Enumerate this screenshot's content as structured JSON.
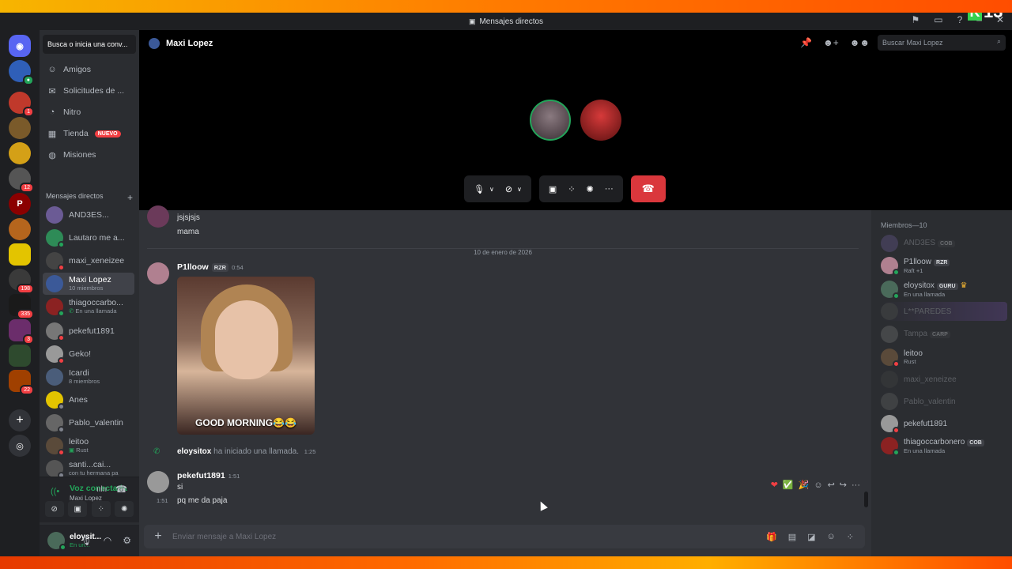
{
  "window": {
    "title": "Mensajes directos",
    "badge_letter": "K",
    "badge_number": "13"
  },
  "sidebar": {
    "search_label": "Busca o inicia una conv...",
    "nav": [
      {
        "label": "Amigos",
        "icon": "friends-icon"
      },
      {
        "label": "Solicitudes de ...",
        "icon": "mail-icon"
      },
      {
        "label": "Nitro",
        "icon": "nitro-icon"
      },
      {
        "label": "Tienda",
        "icon": "shop-icon",
        "badge": "NUEVO"
      },
      {
        "label": "Misiones",
        "icon": "quests-icon"
      }
    ],
    "dm_header": "Mensajes directos",
    "dms": [
      {
        "name": "AND3ES...",
        "sub": ""
      },
      {
        "name": "Lautaro me a...",
        "sub": ""
      },
      {
        "name": "maxi_xeneizee",
        "sub": ""
      },
      {
        "name": "Maxi Lopez",
        "sub": "10 miembros"
      },
      {
        "name": "thiagoccarbo...",
        "sub": "En una llamada"
      },
      {
        "name": "pekefut1891",
        "sub": ""
      },
      {
        "name": "Geko!",
        "sub": ""
      },
      {
        "name": "Icardi",
        "sub": "8 miembros"
      },
      {
        "name": "Anes",
        "sub": ""
      },
      {
        "name": "Pablo_valentin",
        "sub": ""
      },
      {
        "name": "leitoo",
        "sub": "Rust"
      },
      {
        "name": "santi...cai...",
        "sub": "con tu hermana pa"
      }
    ],
    "guild_badges": [
      "1",
      "12",
      "198",
      "335",
      "3",
      "22"
    ],
    "voice": {
      "status": "Voz conectada",
      "channel": "Maxi Lopez"
    },
    "user": {
      "name": "eloysit...",
      "sub": "En un..."
    }
  },
  "call": {
    "title": "Maxi Lopez",
    "search_placeholder": "Buscar Maxi Lopez"
  },
  "chat": {
    "prev_lines": [
      "jsjsjsjs",
      "mama"
    ],
    "date_divider": "10 de enero de 2026",
    "messages": [
      {
        "author": "P1lloow",
        "tag": "RZR",
        "time": "0:54",
        "gif_caption": "GOOD MORNING😂😂"
      },
      {
        "author": "eloysitox",
        "system": "ha iniciado una llamada.",
        "time": "1:25"
      },
      {
        "author": "pekefut1891",
        "time": "1:51",
        "lines": [
          "si",
          "pq me da paja"
        ],
        "line_time": "1:51"
      }
    ],
    "composer_placeholder": "Enviar mensaje a Maxi Lopez"
  },
  "members": {
    "header": "Miembros—10",
    "list": [
      {
        "name": "AND3ES",
        "badge": "COB",
        "sub": "",
        "dim": true
      },
      {
        "name": "P1lloow",
        "badge": "RZR",
        "sub": "Raft +1",
        "dim": false
      },
      {
        "name": "eloysitox",
        "badge": "GURU",
        "sub": "En una llamada",
        "dim": false
      },
      {
        "name": "L**PAREDES",
        "badge": "",
        "sub": "",
        "dim": true
      },
      {
        "name": "Tampa",
        "badge": "CARP",
        "sub": "",
        "dim": true
      },
      {
        "name": "leitoo",
        "badge": "",
        "sub": "Rust",
        "dim": false
      },
      {
        "name": "maxi_xeneizee",
        "badge": "",
        "sub": "",
        "dim": true
      },
      {
        "name": "Pablo_valentin",
        "badge": "",
        "sub": "",
        "dim": true
      },
      {
        "name": "pekefut1891",
        "badge": "",
        "sub": "",
        "dim": false
      },
      {
        "name": "thiagoccarbonero",
        "badge": "COB",
        "sub": "En una llamada",
        "dim": false
      }
    ]
  },
  "colors": {
    "accent": "#5865f2",
    "online": "#23a55a",
    "danger": "#da373c",
    "idle": "#f0b232",
    "dnd": "#f23f43"
  }
}
